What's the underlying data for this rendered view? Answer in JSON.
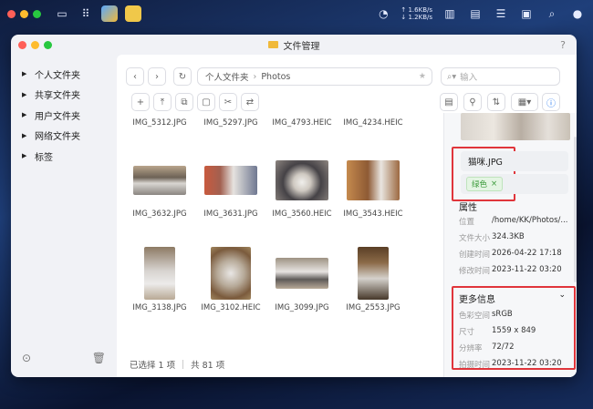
{
  "system_bar": {
    "net_up": "↑ 1.6KB/s",
    "net_down": "↓ 1.2KB/s"
  },
  "window": {
    "title": "文件管理",
    "help": "?"
  },
  "sidebar": {
    "items": [
      {
        "label": "个人文件夹"
      },
      {
        "label": "共享文件夹"
      },
      {
        "label": "用户文件夹"
      },
      {
        "label": "网络文件夹"
      },
      {
        "label": "标签"
      }
    ]
  },
  "path": {
    "root": "个人文件夹",
    "separator": "›",
    "current": "Photos"
  },
  "search": {
    "placeholder": "输入"
  },
  "files": [
    {
      "name": "IMG_5312.JPG"
    },
    {
      "name": "IMG_5297.JPG"
    },
    {
      "name": "IMG_4793.HEIC"
    },
    {
      "name": "IMG_4234.HEIC"
    },
    {
      "name": "IMG_3632.JPG"
    },
    {
      "name": "IMG_3631.JPG"
    },
    {
      "name": "IMG_3560.HEIC"
    },
    {
      "name": "IMG_3543.HEIC"
    },
    {
      "name": "IMG_3138.JPG"
    },
    {
      "name": "IMG_3102.HEIC"
    },
    {
      "name": "IMG_3099.JPG"
    },
    {
      "name": "IMG_2553.JPG"
    }
  ],
  "status": {
    "selected": "已选择 1 项",
    "total": "共 81 项"
  },
  "detail": {
    "filename": "猫咪.JPG",
    "tag": "绿色",
    "tag_remove": "×",
    "tag_color": "#3a9a3a",
    "properties_title": "属性",
    "properties": [
      {
        "key": "位置",
        "value": "/home/KK/Photos/..."
      },
      {
        "key": "文件大小",
        "value": "324.3KB"
      },
      {
        "key": "创建时间",
        "value": "2026-04-22 17:18"
      },
      {
        "key": "修改时间",
        "value": "2023-11-22 03:20"
      }
    ],
    "more_title": "更多信息",
    "more": [
      {
        "key": "色彩空间",
        "value": "sRGB"
      },
      {
        "key": "尺寸",
        "value": "1559 x 849"
      },
      {
        "key": "分辨率",
        "value": "72/72"
      },
      {
        "key": "拍摄时间",
        "value": "2023-11-22 03:20"
      }
    ]
  },
  "colors": {
    "highlight": "#e0353b",
    "accent": "#2b7cf0"
  }
}
